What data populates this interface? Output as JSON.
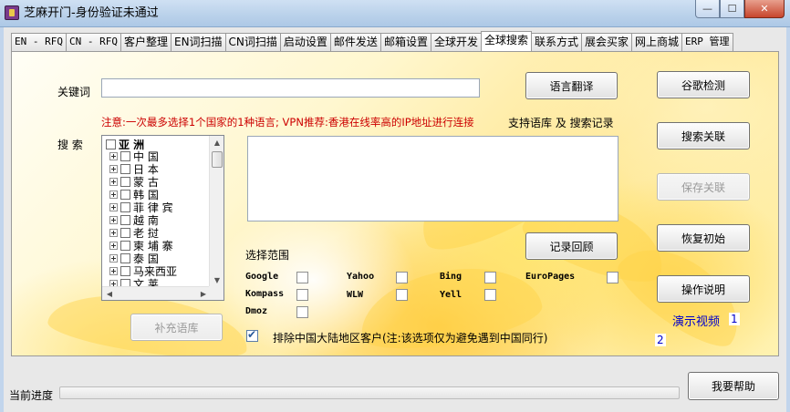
{
  "window": {
    "title": "芝麻开门-身份验证未通过",
    "controls": {
      "minimize": "—",
      "maximize": "☐",
      "close": "✕"
    }
  },
  "tabs": [
    {
      "label": "EN - RFQ",
      "active": false
    },
    {
      "label": "CN - RFQ",
      "active": false
    },
    {
      "label": "客户整理",
      "active": false
    },
    {
      "label": "EN词扫描",
      "active": false
    },
    {
      "label": "CN词扫描",
      "active": false
    },
    {
      "label": "启动设置",
      "active": false
    },
    {
      "label": "邮件发送",
      "active": false
    },
    {
      "label": "邮箱设置",
      "active": false
    },
    {
      "label": "全球开发",
      "active": false
    },
    {
      "label": "全球搜索",
      "active": true
    },
    {
      "label": "联系方式",
      "active": false
    },
    {
      "label": "展会买家",
      "active": false
    },
    {
      "label": "网上商城",
      "active": false
    },
    {
      "label": "ERP 管理",
      "active": false
    }
  ],
  "search": {
    "keyword_label": "关键词",
    "keyword_value": "",
    "translate_button": "语言翻译",
    "notice": "注意:一次最多选择1个国家的1种语言;  VPN推荐:香港在线率高的IP地址进行连接",
    "support_text": "支持语库 及 搜索记录",
    "search_label": "搜  索",
    "records_text": "",
    "history_button": "记录回顾",
    "supplement_button": "补充语库"
  },
  "tree": {
    "root": "亚    洲",
    "items": [
      "中    国",
      "日    本",
      "蒙    古",
      "韩    国",
      "菲 律 宾",
      "越    南",
      "老    挝",
      "柬 埔 寨",
      "泰    国",
      "马来西亚",
      "文    莱"
    ]
  },
  "scope": {
    "label": "选择范围",
    "engines": [
      {
        "name": "Google",
        "checked": false
      },
      {
        "name": "Yahoo",
        "checked": false
      },
      {
        "name": "Bing",
        "checked": false
      },
      {
        "name": "EuroPages",
        "checked": false
      },
      {
        "name": "Kompass",
        "checked": false
      },
      {
        "name": "WLW",
        "checked": false
      },
      {
        "name": "Yell",
        "checked": false
      },
      {
        "name": "Dmoz",
        "checked": false
      }
    ],
    "exclude_label": "排除中国大陆地区客户(注:该选项仅为避免遇到中国同行)",
    "exclude_checked": true
  },
  "right_buttons": {
    "google_check": "谷歌检测",
    "search_related": "搜索关联",
    "save_related": "保存关联",
    "restore_initial": "恢复初始",
    "instructions": "操作说明"
  },
  "videos": {
    "label": "演示视频",
    "link1": "1",
    "link2": "2"
  },
  "footer": {
    "progress_label": "当前进度",
    "progress_value": 0,
    "help_button": "我要帮助"
  },
  "colors": {
    "notice_red": "#cc0000",
    "link_blue": "#0000cc",
    "panel_accent": "#ffd54a"
  }
}
